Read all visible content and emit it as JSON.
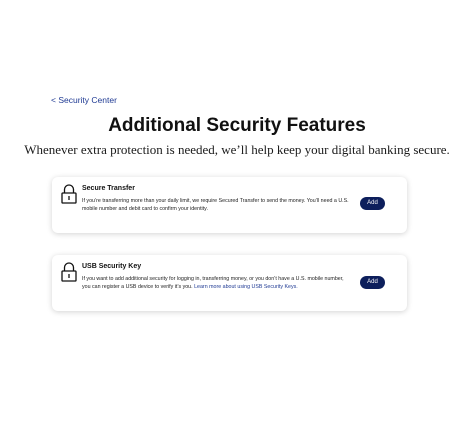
{
  "breadcrumb": {
    "back_label": "< Security Center"
  },
  "header": {
    "title": "Additional Security Features",
    "subtitle": "Whenever extra protection is needed, we’ll help keep your digital banking secure."
  },
  "features": [
    {
      "icon": "lock-icon",
      "title": "Secure Transfer",
      "description": "If you’re transferring more than your daily limit, we require Secured Transfer to send the money. You’ll need a U.S. mobile number and debit card to confirm your identity.",
      "link_text": "",
      "button_label": "Add"
    },
    {
      "icon": "lock-icon",
      "title": "USB Security Key",
      "description": "If you want to add additional security for logging in, transferring money, or you don’t have a U.S. mobile number, you can register a USB device to verify it’s you.",
      "link_text": "Learn more about using USB Security Keys.",
      "button_label": "Add"
    }
  ],
  "colors": {
    "link": "#1f3a93",
    "button_bg": "#0d1f5c",
    "button_text": "#ffffff"
  }
}
